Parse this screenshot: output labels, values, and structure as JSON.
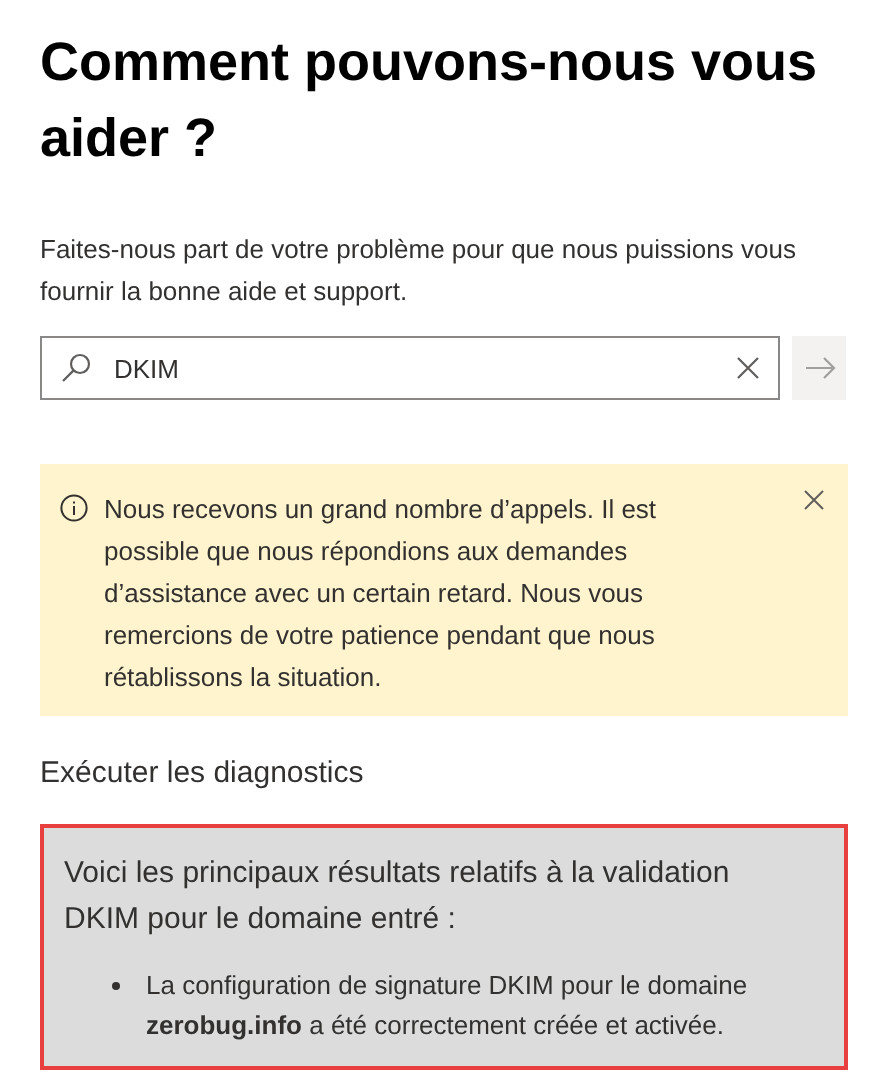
{
  "title": "Comment pouvons-nous vous aider ?",
  "intro": "Faites-nous part de votre problème pour que nous puissions vous fournir la bonne aide et support.",
  "search": {
    "value": "DKIM",
    "submit_disabled": true
  },
  "notice": {
    "text": "Nous recevons un grand nombre d’appels. Il est possible que nous répondions aux demandes d’assistance avec un certain retard. Nous vous remercions de votre patience pendant que nous rétablissons la situation."
  },
  "diagnostics": {
    "heading": "Exécuter les diagnostics",
    "result_title": "Voici les principaux résultats relatifs à la validation DKIM pour le domaine entré :",
    "items": [
      "La configuration de signature DKIM pour le domaine **zerobug.info** a été correctement créée et activée."
    ]
  }
}
